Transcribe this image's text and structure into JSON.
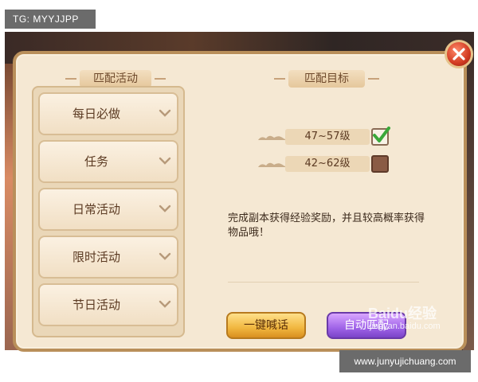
{
  "watermarks": {
    "top_left": "TG: MYYJJPP",
    "bottom_right": "www.junyujichuang.com",
    "baidu_logo": "Baidu经验",
    "baidu_url": "jingyan.baidu.com"
  },
  "left_panel": {
    "title": "匹配活动",
    "items": [
      {
        "label": "每日必做",
        "icon": "chevron-down-icon"
      },
      {
        "label": "任务",
        "icon": "chevron-down-icon"
      },
      {
        "label": "日常活动",
        "icon": "chevron-down-icon"
      },
      {
        "label": "限时活动",
        "icon": "chevron-down-icon"
      },
      {
        "label": "节日活动",
        "icon": "chevron-down-icon"
      }
    ]
  },
  "right_panel": {
    "title": "匹配目标",
    "levels": [
      {
        "label": "47~57级",
        "checked": true
      },
      {
        "label": "42~62级",
        "checked": false
      }
    ],
    "description": "完成副本获得经验奖励，并且较高概率获得物品哦！",
    "buttons": {
      "shout": "一键喊话",
      "auto_match": "自动匹配"
    }
  },
  "colors": {
    "panel_bg": "#f5e8d3",
    "accent_gold": "#f1b740",
    "accent_purple": "#a064e8",
    "close_red": "#d23b22",
    "check_green": "#3aa83a"
  }
}
